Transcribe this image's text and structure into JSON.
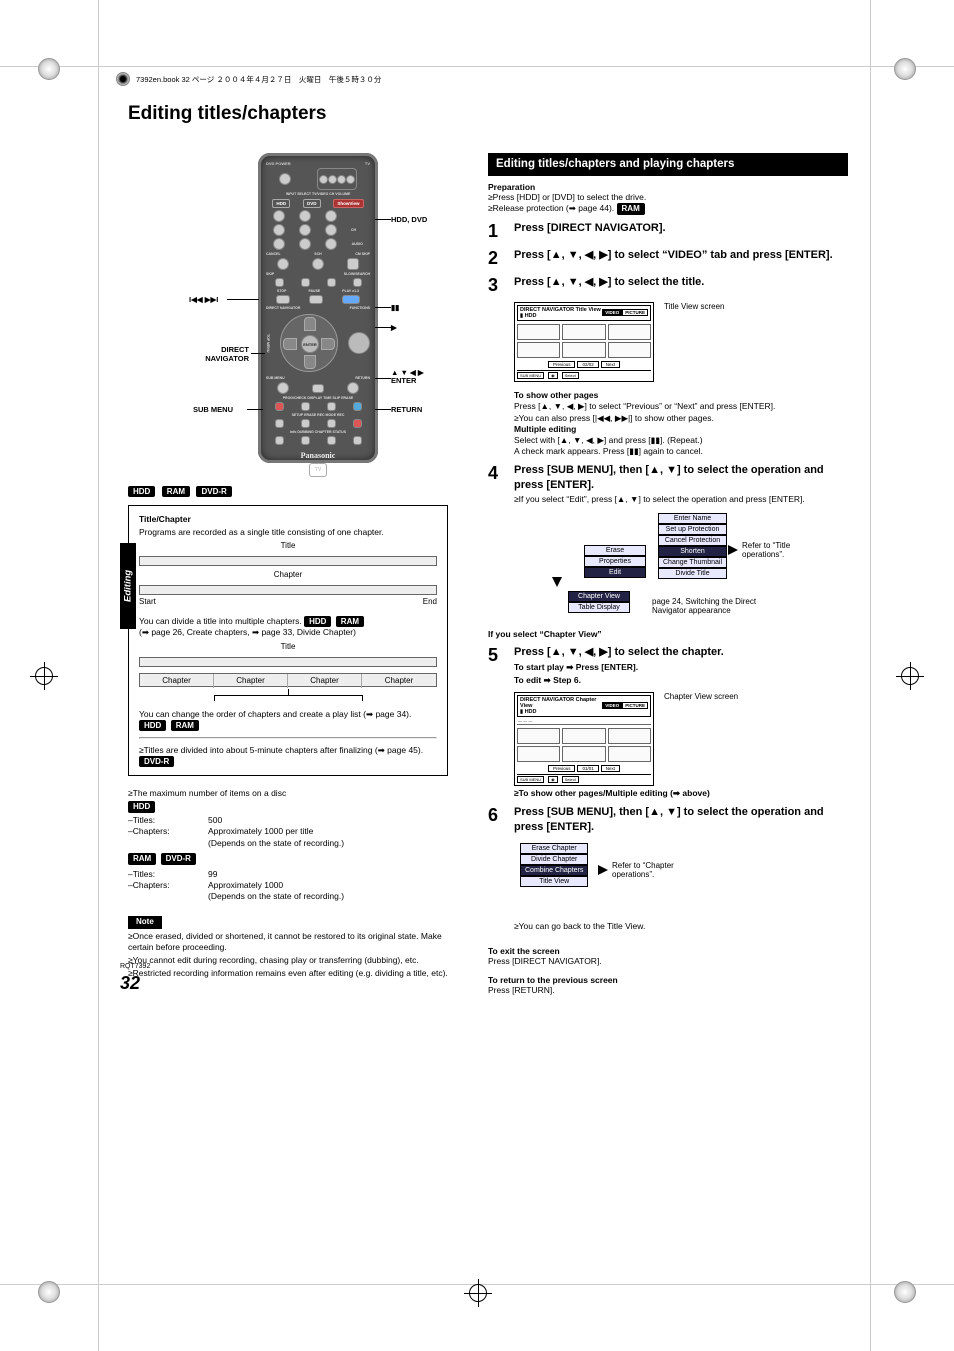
{
  "meta": {
    "footer_header": "7392en.book  32 ページ  ２００４年４月２７日　火曜日　午後５時３０分",
    "rqt": "RQT7392",
    "page_number": "32",
    "side_tab": "Editing"
  },
  "title": "Editing titles/chapters",
  "remote": {
    "labels": {
      "skip": "",
      "hdd_dvd": "HDD, DVD",
      "pause": "",
      "play": "",
      "direct_nav": "DIRECT\nNAVIGATOR",
      "mid_right": "▲ ▼ ◀ ▶\nENTER",
      "sub_menu": "SUB MENU",
      "return": "RETURN"
    },
    "top_tiny": "DVD POWER",
    "tv_tiny": "TV",
    "input_sel": "INPUT SELECT  TV/VIDEO   CH  VOLUME",
    "hdd": "HDD",
    "dvd": "DVD",
    "vhs": "ShowView",
    "audio": "AUDIO",
    "cancel": "CANCEL",
    "sch": "SCH",
    "cm": "CM SKIP",
    "skip_row": "SKIP",
    "slow": "SLOW/SEARCH",
    "stop": "STOP",
    "pause_b": "PAUSE",
    "play_b": "PLAY x1.3",
    "dn": "DIRECT NAVIGATOR",
    "fn": "FUNCTIONS",
    "topmenu": "TOP MENU",
    "enter": "ENTER",
    "submenu_b": "SUB MENU",
    "return_b": "RETURN",
    "row1": "PROG/CHECK  DISPLAY  TIME SLIP  ERASE",
    "row2": "SETUP   ERASE  REC MODE  REC",
    "row3": "Info   DUBBING  CHAPTER  STATUS",
    "brand": "Panasonic"
  },
  "disc_pills": {
    "hdd": "HDD",
    "ram": "RAM",
    "dvdr": "DVD-R"
  },
  "tc": {
    "heading": "Title/Chapter",
    "line1": "Programs are recorded as a single title consisting of one chapter.",
    "title": "Title",
    "chapter": "Chapter",
    "start": "Start",
    "end": "End",
    "line2_a": "You can divide a title into multiple chapters.",
    "line2_b": "(➡ page 26, Create chapters, ➡ page 33, Divide Chapter)",
    "chapters": [
      "Chapter",
      "Chapter",
      "Chapter",
      "Chapter"
    ],
    "line3": "You can change the order of chapters and create a play list (➡ page 34).",
    "line4": "≥Titles are divided into about 5-minute chapters after finalizing (➡ page 45)."
  },
  "max": {
    "intro": "≥The maximum number of items on a disc",
    "hdd_titles_label": "–Titles:",
    "hdd_titles_val": "500",
    "hdd_ch_label": "–Chapters:",
    "hdd_ch_val": "Approximately 1000 per title\n(Depends on the state of recording.)",
    "ram_titles_label": "–Titles:",
    "ram_titles_val": "99",
    "ram_ch_label": "–Chapters:",
    "ram_ch_val": "Approximately 1000\n(Depends on the state of recording.)"
  },
  "note": {
    "label": "Note",
    "n1": "≥Once erased, divided or shortened, it cannot be restored to its original state. Make certain before proceeding.",
    "n2": "≥You cannot edit during recording, chasing play or transferring (dubbing), etc.",
    "n3": "≥Restricted recording information remains even after editing (e.g. dividing a title, etc)."
  },
  "right": {
    "bar": "Editing titles/chapters and playing chapters",
    "prep": "Preparation",
    "prep1": "≥Press [HDD] or [DVD] to select the drive.",
    "prep2": "≥Release protection (➡ page 44).",
    "ram": "RAM",
    "step1": "Press [DIRECT NAVIGATOR].",
    "step2": "Press [▲, ▼, ◀, ▶] to select “VIDEO” tab and press [ENTER].",
    "step3": "Press [▲, ▼, ◀, ▶] to select the title.",
    "title_screen_label": "Title View screen",
    "sc1": {
      "h": "DIRECT NAVIGATOR   Title View",
      "sub": "HDD",
      "tabs": [
        "VIDEO",
        "PICTURE"
      ],
      "prev": "Previous",
      "page": "02/02",
      "next": "Next",
      "foot1": "SUB MENU",
      "foot2": "Select"
    },
    "pages": {
      "h": "To show other pages",
      "p1": "Press [▲, ▼, ◀, ▶] to select “Previous” or “Next” and press [ENTER].",
      "p2": "≥You can also press [|◀◀, ▶▶|] to show other pages.",
      "h2": "Multiple editing",
      "p3": "Select with [▲, ▼, ◀, ▶] and press [▮▮]. (Repeat.)",
      "p4": "A check mark appears. Press [▮▮] again to cancel."
    },
    "step4": "Press [SUB MENU], then [▲, ▼] to select the operation and press [ENTER].",
    "step4_sub": "≥If you select “Edit”, press [▲, ▼] to select the operation and press [ENTER].",
    "menus": {
      "left": [
        "Erase",
        "Properties",
        "Edit",
        "Chapter View",
        "Table Display"
      ],
      "right": [
        "Enter Name",
        "Set up Protection",
        "Cancel Protection",
        "Shorten",
        "Change Thumbnail",
        "Divide Title"
      ],
      "ref1": "Refer to “Title operations”.",
      "ref2": "page 24, Switching the Direct Navigator appearance"
    },
    "if_chapter": "If you select “Chapter View”",
    "step5": "Press [▲, ▼, ◀, ▶] to select the chapter.",
    "step5_a": "To start play ➡ Press [ENTER].",
    "step5_b": "To edit ➡ Step 6.",
    "cv_label": "Chapter View screen",
    "sc2": {
      "h": "DIRECT NAVIGATOR   Chapter View",
      "sub": "HDD",
      "tabs": [
        "VIDEO",
        "PICTURE"
      ],
      "row_txt": "—  —  —",
      "prev": "Previous",
      "page": "01/01",
      "next": "Next",
      "foot1": "SUB MENU",
      "foot2": "Select"
    },
    "step5_note": "≥To show other pages/Multiple editing (➡ above)",
    "step6": "Press [SUB MENU], then [▲, ▼] to select the operation and press [ENTER].",
    "chap_menu": [
      "Erase Chapter",
      "Divide Chapter",
      "Combine Chapters",
      "Title View"
    ],
    "chap_ref": "Refer to “Chapter operations”.",
    "chap_note": "≥You can go back to the Title View.",
    "exit_h": "To exit the screen",
    "exit_t": "Press [DIRECT NAVIGATOR].",
    "prev_h": "To return to the previous screen",
    "prev_t": "Press [RETURN]."
  }
}
